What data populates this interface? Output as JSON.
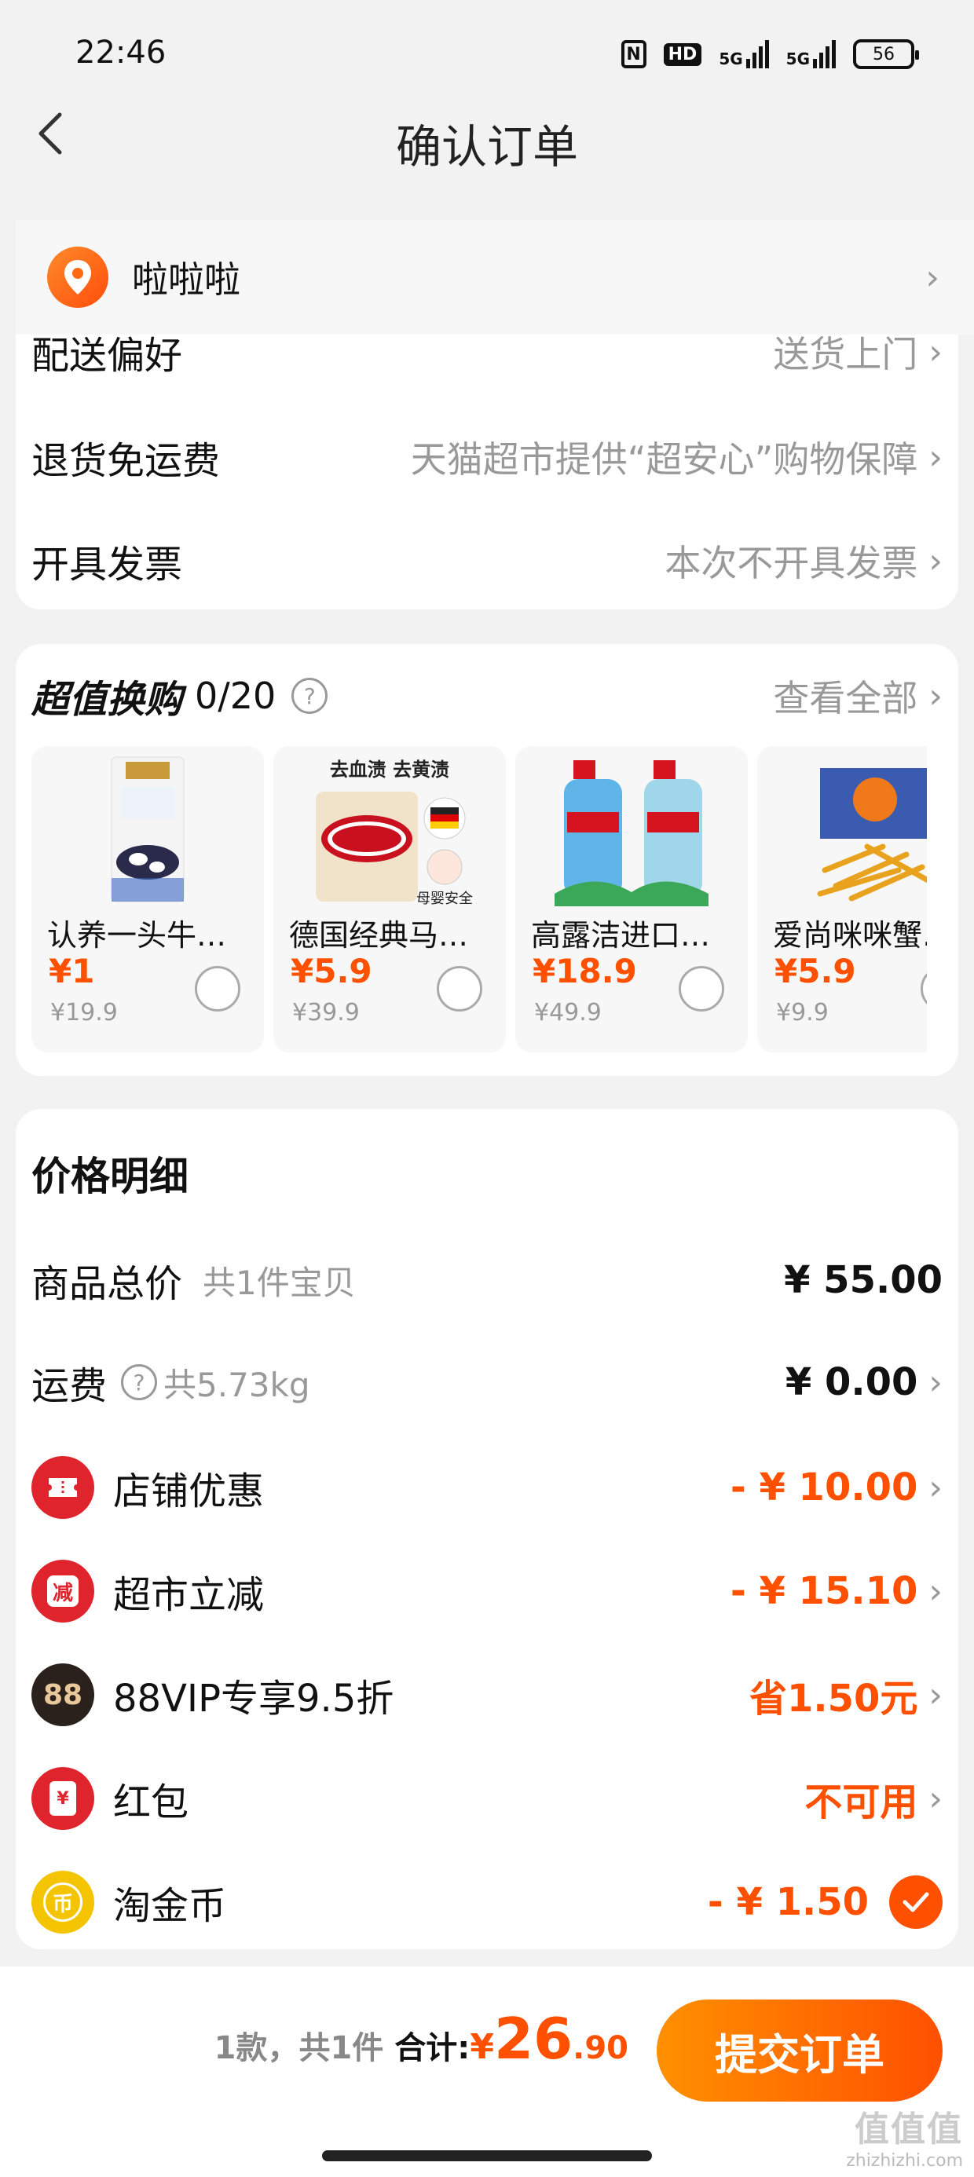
{
  "status_bar": {
    "time": "22:46",
    "nfc": "N",
    "hd": "HD",
    "signal1": "5G",
    "signal2": "5G",
    "battery": "56"
  },
  "nav": {
    "title": "确认订单"
  },
  "address": {
    "name": "啦啦啦"
  },
  "delivery": [
    {
      "label": "配送偏好",
      "value": "送货上门"
    },
    {
      "label": "退货免运费",
      "value": "天猫超市提供“超安心”购物保障"
    },
    {
      "label": "开具发票",
      "value": "本次不开具发票"
    }
  ],
  "swap": {
    "title": "超值换购",
    "count": "0/20",
    "see_all": "查看全部",
    "products": [
      {
        "name": "认养一头牛纯牛奶",
        "price": "¥1",
        "original": "¥19.9",
        "image": "milk-carton"
      },
      {
        "name": "德国经典马赛皂",
        "price": "¥5.9",
        "original": "¥39.9",
        "image": "soap-box",
        "image_caption_top": "去血渍 去黄渍",
        "image_caption_bottom": "母婴安全"
      },
      {
        "name": "高露洁进口抑菌漱口水",
        "price": "¥18.9",
        "original": "¥49.9",
        "image": "mouthwash-bottles"
      },
      {
        "name": "爱尚咪咪蟹味粒",
        "price": "¥5.9",
        "original": "¥9.9",
        "image": "snack-bag"
      }
    ]
  },
  "price_detail": {
    "title": "价格明细",
    "items": [
      {
        "label": "商品总价",
        "sub": "共1件宝贝",
        "value": "¥ 55.00"
      },
      {
        "label": "运费",
        "sub": "共5.73kg",
        "value": "¥ 0.00"
      },
      {
        "label": "店铺优惠",
        "value": "- ¥ 10.00",
        "icon": "coupon-icon",
        "color": "#e0242e"
      },
      {
        "label": "超市立减",
        "value": "- ¥ 15.10",
        "icon": "discount-icon",
        "color": "#e0242e",
        "icon_text": "减"
      },
      {
        "label": "88VIP专享9.5折",
        "value": "省1.50元",
        "icon": "vip-88-icon",
        "color": "#2b211c",
        "icon_text": "88"
      },
      {
        "label": "红包",
        "value": "不可用",
        "icon": "red-packet-icon",
        "color": "#e0242e",
        "icon_text": "¥"
      },
      {
        "label": "淘金币",
        "value": "- ¥ 1.50",
        "icon": "gold-coin-icon",
        "color": "#f5c400",
        "icon_text": "币"
      }
    ]
  },
  "footer": {
    "count_text": "1款，共1件",
    "total_label": "合计:",
    "currency": "¥",
    "total_int": "26",
    "total_dec": ".90",
    "submit": "提交订单"
  },
  "watermark": {
    "line1": "值值值",
    "line2": "zhizhizhi.com"
  },
  "colors": {
    "accent": "#ff5000",
    "muted": "#999999",
    "background": "#f2f2f2"
  }
}
